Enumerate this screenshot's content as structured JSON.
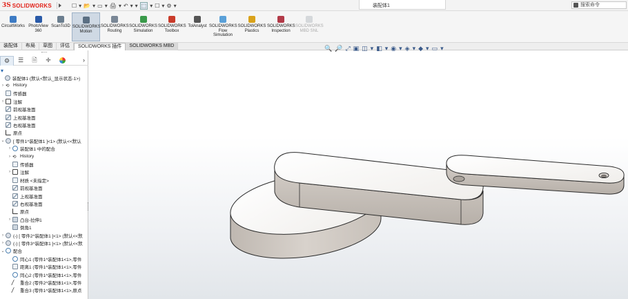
{
  "app": {
    "logo_ds": "3S",
    "logo_word": "SOLIDWORKS"
  },
  "titlebar": {
    "document_title": "装配体1",
    "search_placeholder": "搜索命令",
    "quick_access": [
      "☐",
      "▾",
      "📂",
      "▾",
      "▭",
      "▾",
      "🖨",
      "▾",
      "↶",
      "▾",
      "▾",
      "⬚",
      "▾",
      "☐",
      "▾",
      "⚙",
      "▾"
    ]
  },
  "command_manager": {
    "items": [
      {
        "label": "CircuitWorks",
        "color": "#3d7bc4",
        "active": false,
        "disabled": false
      },
      {
        "label": "PhotoView 360",
        "color": "#2a5aa8",
        "active": false,
        "disabled": false
      },
      {
        "label": "ScanTo3D",
        "color": "#6b7e8f",
        "active": false,
        "disabled": false
      },
      {
        "label": "SOLIDWORKS Motion",
        "color": "#5b6f83",
        "active": true,
        "disabled": false
      },
      {
        "label": "SOLIDWORKS Routing",
        "color": "#7a8796",
        "active": false,
        "disabled": false
      },
      {
        "label": "SOLIDWORKS Simulation",
        "color": "#3a9a4a",
        "active": false,
        "disabled": false
      },
      {
        "label": "SOLIDWORKS Toolbox",
        "color": "#c93b2a",
        "active": false,
        "disabled": false
      },
      {
        "label": "TolAnalyst",
        "color": "#555555",
        "active": false,
        "disabled": false
      },
      {
        "label": "SOLIDWORKS Flow Simulation",
        "color": "#5aa0d8",
        "active": false,
        "disabled": false
      },
      {
        "label": "SOLIDWORKS Plastics",
        "color": "#d9a21b",
        "active": false,
        "disabled": false
      },
      {
        "label": "SOLIDWORKS Inspection",
        "color": "#b23a48",
        "active": false,
        "disabled": false
      },
      {
        "label": "SOLIDWORKS MBD SNL",
        "color": "#9aa3ad",
        "active": false,
        "disabled": true
      }
    ]
  },
  "tabs": [
    {
      "label": "装配体",
      "state": "normal"
    },
    {
      "label": "布局",
      "state": "normal"
    },
    {
      "label": "草图",
      "state": "normal"
    },
    {
      "label": "评估",
      "state": "normal"
    },
    {
      "label": "SOLIDWORKS 插件",
      "state": "active"
    },
    {
      "label": "SOLIDWORKS MBD",
      "state": "gray"
    }
  ],
  "view_toolbar": [
    "🔍",
    "🔎",
    "⤢",
    "▣",
    "◫",
    "▾",
    "◧",
    "▾",
    "◉",
    "▾",
    "◈",
    "▾",
    "◆",
    "▾",
    "▭",
    "▾"
  ],
  "left_panel": {
    "tabs": [
      "⚙",
      "☰",
      "🗎",
      "✛",
      "●"
    ],
    "chevron": "›",
    "filter": "▾",
    "tree": [
      {
        "label": "装配体1 (默认<默认_显示状态-1>)",
        "level": 0,
        "exp": "",
        "icon": "asm"
      },
      {
        "label": "History",
        "level": 1,
        "exp": "›",
        "icon": "hist"
      },
      {
        "label": "传感器",
        "level": 1,
        "exp": "",
        "icon": "ic"
      },
      {
        "label": "注解",
        "level": 1,
        "exp": "›",
        "icon": "ann"
      },
      {
        "label": "前视基准面",
        "level": 1,
        "exp": "",
        "icon": "plane"
      },
      {
        "label": "上视基准面",
        "level": 1,
        "exp": "",
        "icon": "plane"
      },
      {
        "label": "右视基准面",
        "level": 1,
        "exp": "",
        "icon": "plane"
      },
      {
        "label": "原点",
        "level": 1,
        "exp": "",
        "icon": "origin"
      },
      {
        "label": "[ 零件1^装配体1 ]<1> (默认<<默认",
        "level": 1,
        "exp": "⌄",
        "icon": "asm"
      },
      {
        "label": "装配体1 中的配合",
        "level": 2,
        "exp": "›",
        "icon": "mate"
      },
      {
        "label": "History",
        "level": 2,
        "exp": "›",
        "icon": "hist"
      },
      {
        "label": "传感器",
        "level": 2,
        "exp": "",
        "icon": "ic"
      },
      {
        "label": "注解",
        "level": 2,
        "exp": "›",
        "icon": "ann"
      },
      {
        "label": "材质 <未指定>",
        "level": 2,
        "exp": "",
        "icon": "ic"
      },
      {
        "label": "前视基准面",
        "level": 2,
        "exp": "",
        "icon": "plane"
      },
      {
        "label": "上视基准面",
        "level": 2,
        "exp": "",
        "icon": "plane"
      },
      {
        "label": "右视基准面",
        "level": 2,
        "exp": "",
        "icon": "plane"
      },
      {
        "label": "原点",
        "level": 2,
        "exp": "",
        "icon": "origin"
      },
      {
        "label": "凸台-拉伸1",
        "level": 2,
        "exp": "›",
        "icon": "feat"
      },
      {
        "label": "倒角1",
        "level": 2,
        "exp": "",
        "icon": "feat"
      },
      {
        "label": "(-) [ 零件2^装配体1 ]<1> (默认<<默",
        "level": 1,
        "exp": "›",
        "icon": "asm"
      },
      {
        "label": "(-) [ 零件3^装配体1 ]<1> (默认<<默",
        "level": 1,
        "exp": "›",
        "icon": "asm"
      },
      {
        "label": "配合",
        "level": 1,
        "exp": "⌄",
        "icon": "mate"
      },
      {
        "label": "同心1 (零件1^装配体1<1>,零件",
        "level": 2,
        "exp": "",
        "icon": "mate"
      },
      {
        "label": "距离1 (零件1^装配体1<1>,零件",
        "level": 2,
        "exp": "",
        "icon": "ic"
      },
      {
        "label": "同心2 (零件1^装配体1<1>,零件",
        "level": 2,
        "exp": "",
        "icon": "mate"
      },
      {
        "label": "重合2 (零件2^装配体1<1>,零件",
        "level": 2,
        "exp": "",
        "icon": "coin"
      },
      {
        "label": "重合3 (零件1^装配体1<1>,原点",
        "level": 2,
        "exp": "",
        "icon": "coin"
      }
    ]
  },
  "colors": {
    "accent": "#e2231a",
    "part_face": "#f7f6f4",
    "part_side": "#cbc5bf",
    "part_side_dark": "#b0a9a2",
    "edge": "#2a2a2a"
  }
}
